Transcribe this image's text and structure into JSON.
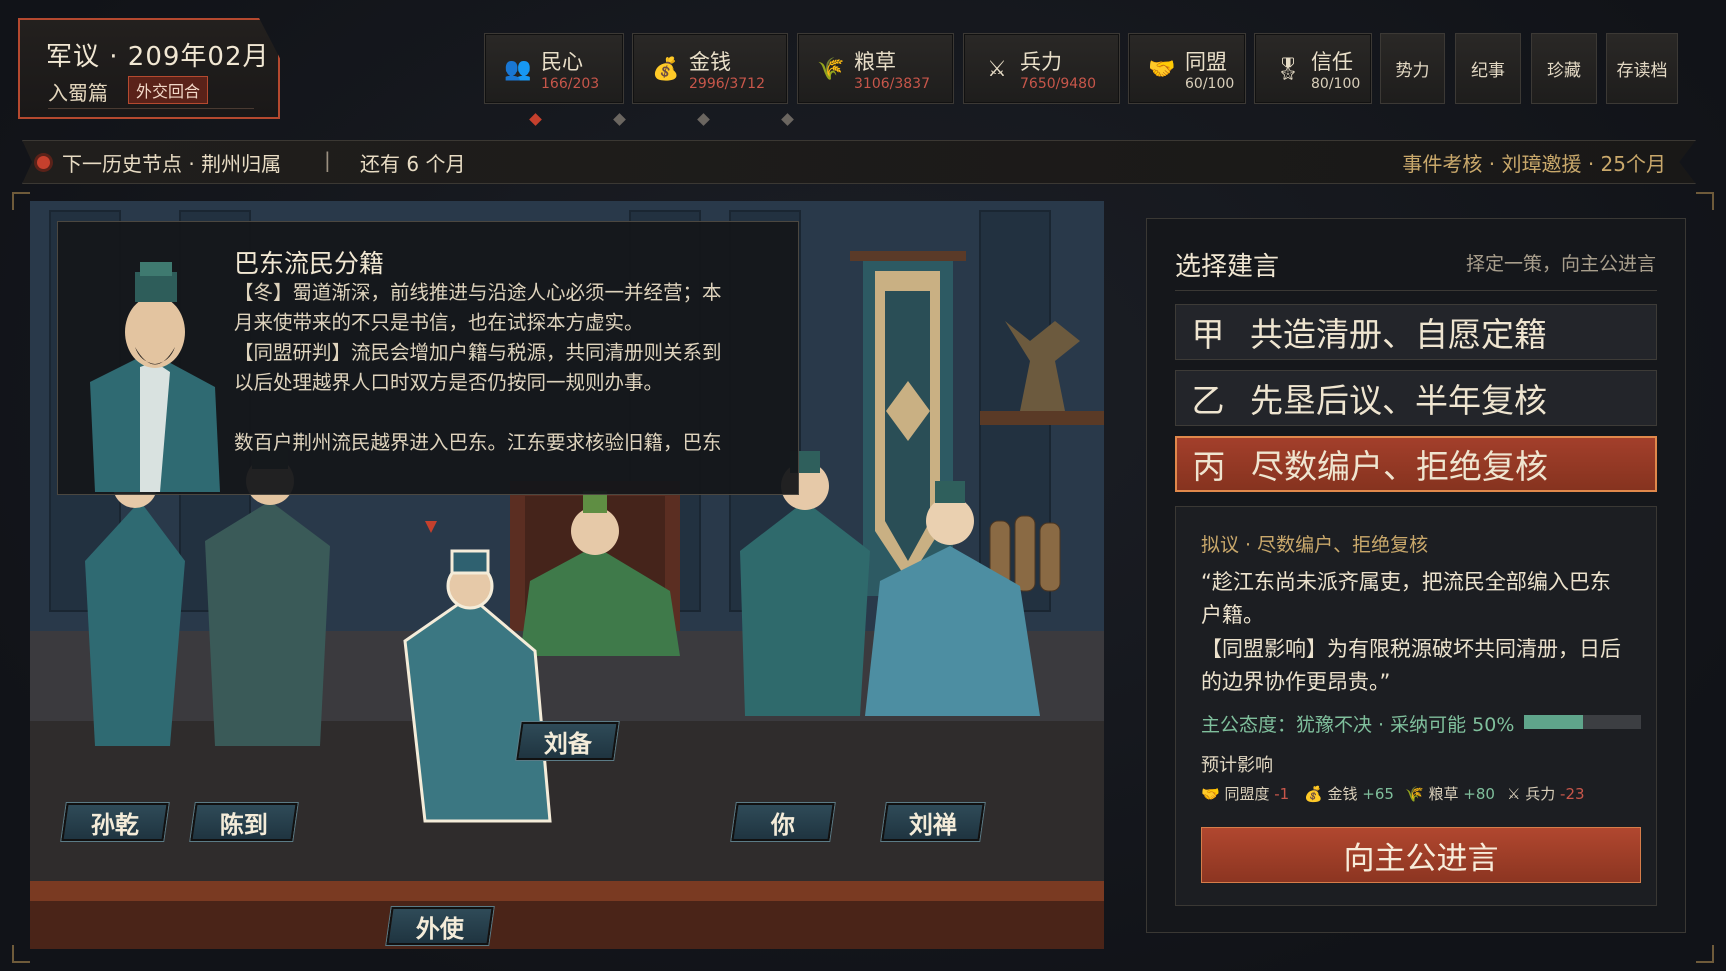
{
  "header": {
    "title": "军议 · 209年02月",
    "chapter": "入蜀篇",
    "phase": "外交回合"
  },
  "resources": [
    {
      "icon": "people-icon",
      "glyph": "👥",
      "name": "民心",
      "value": "166/203",
      "warn": true
    },
    {
      "icon": "gold-coins-icon",
      "glyph": "💰",
      "name": "金钱",
      "value": "2996/3712",
      "warn": true
    },
    {
      "icon": "grain-icon",
      "glyph": "🌾",
      "name": "粮草",
      "value": "3106/3837",
      "warn": true
    },
    {
      "icon": "crossed-swords-icon",
      "glyph": "⚔",
      "name": "兵力",
      "value": "7650/9480",
      "warn": true
    },
    {
      "icon": "alliance-icon",
      "glyph": "🤝",
      "name": "同盟",
      "value": "60/100",
      "warn": false
    },
    {
      "icon": "trust-icon",
      "glyph": "🎖",
      "name": "信任",
      "value": "80/100",
      "warn": false
    }
  ],
  "nav": [
    "势力",
    "纪事",
    "珍藏",
    "存读档"
  ],
  "ticker": {
    "next_label": "下一历史节点 · 荆州归属",
    "separator": "|",
    "remaining": "还有 6 个月",
    "right": "事件考核 · 刘璋邀援 · 25个月"
  },
  "dialog": {
    "heading": "巴东流民分籍",
    "lines": [
      "【冬】蜀道渐深，前线推进与沿途人心必须一并经营；本",
      "月来使带来的不只是书信，也在试探本方虚实。",
      "【同盟研判】流民会增加户籍与税源，共同清册则关系到",
      "以后处理越界人口时双方是否仍按同一规则办事。",
      "数百户荆州流民越界进入巴东。江东要求核验旧籍，巴东"
    ]
  },
  "characters": {
    "sun_qian": "孙乾",
    "chen_dao": "陈到",
    "envoy": "外使",
    "liu_bei": "刘备",
    "you": "你",
    "liu_shan": "刘禅"
  },
  "panel": {
    "title": "选择建言",
    "hint": "择定一策，向主公进言",
    "options": [
      {
        "key": "甲",
        "text": "共造清册、自愿定籍"
      },
      {
        "key": "乙",
        "text": "先垦后议、半年复核"
      },
      {
        "key": "丙",
        "text": "尽数编户、拒绝复核"
      }
    ],
    "selected_index": 2,
    "detail_heading": "拟议 · 尽数编户、拒绝复核",
    "quote_lines": [
      "“趁江东尚未派齐属吏，把流民全部编入巴东",
      "户籍。",
      "【同盟影响】为有限税源破坏共同清册，日后",
      "的边界协作更昂贵。”"
    ],
    "attitude": "主公态度：犹豫不决 · 采纳可能 50%",
    "adopt_probability": 0.5,
    "forecast_label": "预计影响",
    "effects": [
      {
        "icon": "alliance-icon",
        "glyph": "🤝",
        "name": "同盟度",
        "delta": "-1",
        "neg": true
      },
      {
        "icon": "gold-coins-icon",
        "glyph": "💰",
        "name": "金钱",
        "delta": "+65",
        "neg": false
      },
      {
        "icon": "grain-icon",
        "glyph": "🌾",
        "name": "粮草",
        "delta": "+80",
        "neg": false
      },
      {
        "icon": "crossed-swords-icon",
        "glyph": "⚔",
        "name": "兵力",
        "delta": "-23",
        "neg": true
      }
    ],
    "submit_label": "向主公进言"
  },
  "colors": {
    "accent_red": "#b5492f",
    "teal": "#2f4b58",
    "gold": "#c9a86b",
    "green": "#5fa58b"
  }
}
